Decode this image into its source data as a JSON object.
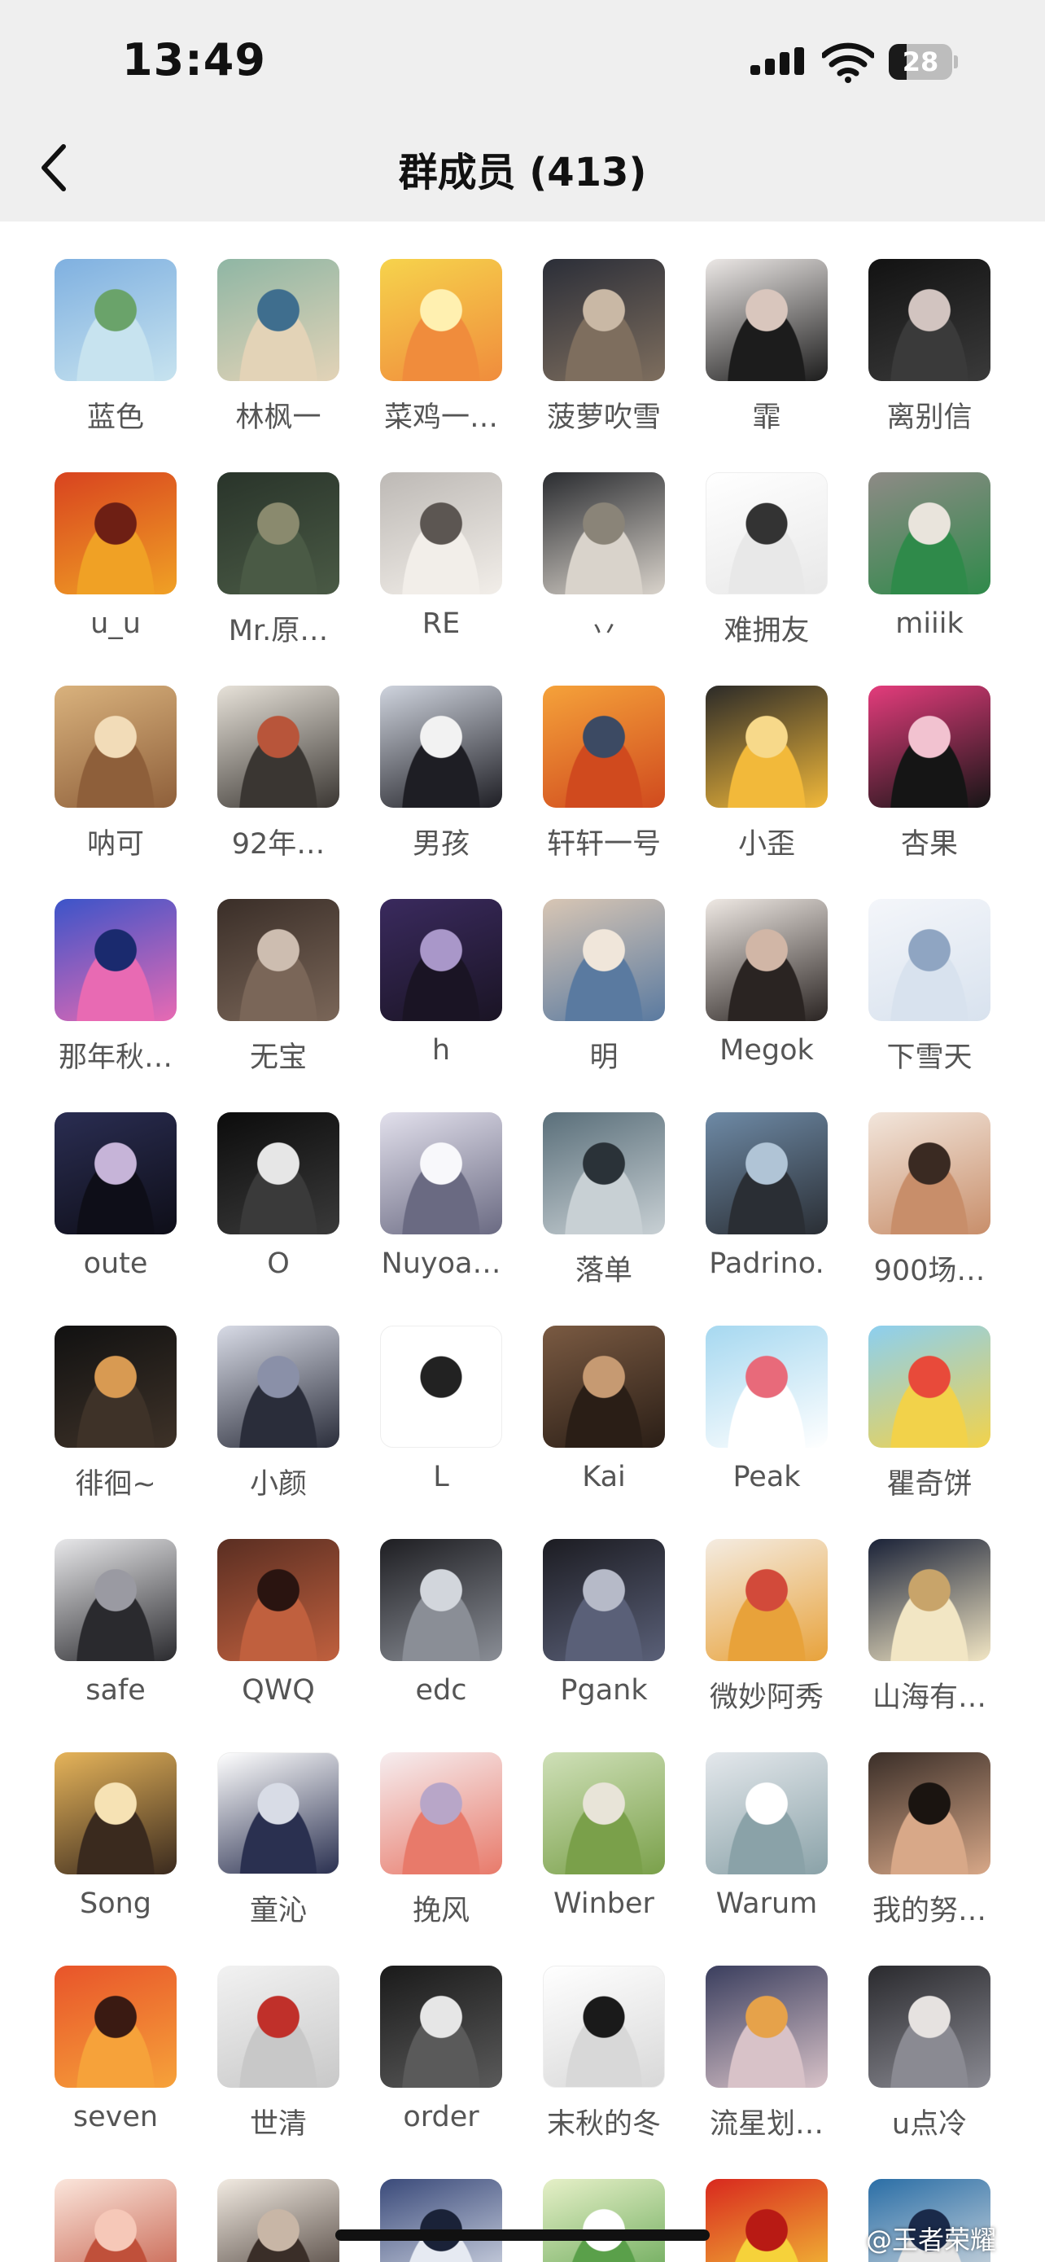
{
  "status_bar": {
    "time": "13:49",
    "battery": "28",
    "battery_fraction": 0.28,
    "icons": [
      "signal-icon",
      "wifi-icon",
      "battery-icon"
    ]
  },
  "nav": {
    "back_icon": "chevron-left-icon",
    "title": "群成员 (413)"
  },
  "members": [
    {
      "name": "蓝色",
      "colors": [
        "#7fb0e0",
        "#c7e3ef",
        "#6aa36a"
      ]
    },
    {
      "name": "林枫一",
      "colors": [
        "#8fb6a4",
        "#e3d3b7",
        "#3f6e8e"
      ]
    },
    {
      "name": "菜鸡一…",
      "colors": [
        "#f6d34c",
        "#f08c3c",
        "#fff0b0"
      ]
    },
    {
      "name": "菠萝吹雪",
      "colors": [
        "#2b2e38",
        "#7e6e5e",
        "#c9b8a5"
      ]
    },
    {
      "name": "霏",
      "colors": [
        "#ece8e6",
        "#1c1c1c",
        "#d9c6bd"
      ]
    },
    {
      "name": "离别信",
      "colors": [
        "#121212",
        "#3a3a3a",
        "#d2c4c0"
      ]
    },
    {
      "name": "u_u",
      "colors": [
        "#d8431f",
        "#f0a125",
        "#6e1f14"
      ]
    },
    {
      "name": "Mr.原…",
      "colors": [
        "#29342a",
        "#4a5a45",
        "#8a8a6e"
      ]
    },
    {
      "name": "RE",
      "colors": [
        "#bdb9b5",
        "#f2eee9",
        "#5c5652"
      ]
    },
    {
      "name": "丷",
      "colors": [
        "#2a2c30",
        "#d9d3cb",
        "#8a8478"
      ]
    },
    {
      "name": "难拥友",
      "colors": [
        "#ffffff",
        "#e8e8e8",
        "#333333"
      ]
    },
    {
      "name": "miiik",
      "colors": [
        "#8e8a86",
        "#2f8a4a",
        "#e9e4dc"
      ]
    },
    {
      "name": "呐可",
      "colors": [
        "#d9b27d",
        "#8e5f3a",
        "#f2dcb8"
      ]
    },
    {
      "name": "92年…",
      "colors": [
        "#e7e2d9",
        "#3a3632",
        "#b8553a"
      ]
    },
    {
      "name": "男孩",
      "colors": [
        "#cfd4de",
        "#1e1e24",
        "#f2f2f2"
      ]
    },
    {
      "name": "轩轩一号",
      "colors": [
        "#f5a23a",
        "#d04a1e",
        "#3c4a63"
      ]
    },
    {
      "name": "小歪",
      "colors": [
        "#2b2a28",
        "#f2b93a",
        "#f7d98a"
      ]
    },
    {
      "name": "杏果",
      "colors": [
        "#e43c7c",
        "#151515",
        "#f2c2d0"
      ]
    },
    {
      "name": "那年秋…",
      "colors": [
        "#3b54c9",
        "#e86ab3",
        "#1a2a6e"
      ]
    },
    {
      "name": "无宝",
      "colors": [
        "#3a2e28",
        "#7a6658",
        "#cdbdb0"
      ]
    },
    {
      "name": "h",
      "colors": [
        "#3a2a5e",
        "#1a1424",
        "#a997c9"
      ]
    },
    {
      "name": "明",
      "colors": [
        "#d8c6b4",
        "#5a7aa0",
        "#f0e6da"
      ]
    },
    {
      "name": "Megok",
      "colors": [
        "#efe9e4",
        "#2a2422",
        "#d1b6a6"
      ]
    },
    {
      "name": "下雪天",
      "colors": [
        "#f4f6fa",
        "#d8e2ee",
        "#8fa5c2"
      ]
    },
    {
      "name": "oute",
      "colors": [
        "#2a2d52",
        "#0e0e18",
        "#c6b4d8"
      ]
    },
    {
      "name": "O",
      "colors": [
        "#0c0c0c",
        "#3a3a3a",
        "#e6e6e6"
      ]
    },
    {
      "name": "Nuyoa…",
      "colors": [
        "#e2e0ec",
        "#6a6a82",
        "#f8f8fb"
      ]
    },
    {
      "name": "落单",
      "colors": [
        "#5a6f7a",
        "#c8d0d4",
        "#2a3238"
      ]
    },
    {
      "name": "Padrino.",
      "colors": [
        "#6e8aa6",
        "#2a2e34",
        "#b0c4d6"
      ]
    },
    {
      "name": "900场…",
      "colors": [
        "#f2e6dc",
        "#c88e6a",
        "#3a2a22"
      ]
    },
    {
      "name": "徘徊~",
      "colors": [
        "#111111",
        "#3e3228",
        "#d89a52"
      ]
    },
    {
      "name": "小颜",
      "colors": [
        "#d8dbe6",
        "#2a2d3a",
        "#8a90a8"
      ]
    },
    {
      "name": "L",
      "colors": [
        "#ffffff",
        "#ffffff",
        "#222222"
      ]
    },
    {
      "name": "Kai",
      "colors": [
        "#7a5a42",
        "#2a1e16",
        "#c69a72"
      ]
    },
    {
      "name": "Peak",
      "colors": [
        "#a6d8f0",
        "#ffffff",
        "#e86a7a"
      ]
    },
    {
      "name": "瞿奇饼",
      "colors": [
        "#8ccff0",
        "#f2d24a",
        "#e84a3a"
      ]
    },
    {
      "name": "safe",
      "colors": [
        "#e8e8ea",
        "#2a2a2e",
        "#9a9aa2"
      ]
    },
    {
      "name": "QWQ",
      "colors": [
        "#5a2e22",
        "#c0603e",
        "#2a1410"
      ]
    },
    {
      "name": "edc",
      "colors": [
        "#1e1e22",
        "#8a8e96",
        "#d2d6dc"
      ]
    },
    {
      "name": "Pgank",
      "colors": [
        "#1c1c22",
        "#5a6078",
        "#b6bac8"
      ]
    },
    {
      "name": "微妙阿秀",
      "colors": [
        "#f4ece2",
        "#e8a23a",
        "#d24a3a"
      ]
    },
    {
      "name": "山海有…",
      "colors": [
        "#1a2238",
        "#f2e6c4",
        "#c8a46a"
      ]
    },
    {
      "name": "Song",
      "colors": [
        "#e6b45a",
        "#3a2a1e",
        "#f6e2b4"
      ]
    },
    {
      "name": "童沁",
      "colors": [
        "#ffffff",
        "#2a3050",
        "#d8dce6"
      ]
    },
    {
      "name": "挽风",
      "colors": [
        "#f6eef0",
        "#e87a6a",
        "#b8a6c8"
      ]
    },
    {
      "name": "Winber",
      "colors": [
        "#cfe0b8",
        "#7aa04a",
        "#e8e4d8"
      ]
    },
    {
      "name": "Warum",
      "colors": [
        "#e4e8ec",
        "#8aa2a8",
        "#ffffff"
      ]
    },
    {
      "name": "我的努…",
      "colors": [
        "#3a2e28",
        "#d8a888",
        "#1a1410"
      ]
    },
    {
      "name": "seven",
      "colors": [
        "#e8542a",
        "#f6a23a",
        "#3a1a12"
      ]
    },
    {
      "name": "世清",
      "colors": [
        "#f2f2f2",
        "#c8c8c8",
        "#c0302a"
      ]
    },
    {
      "name": "order",
      "colors": [
        "#1a1a1a",
        "#5a5a5a",
        "#e6e6e6"
      ]
    },
    {
      "name": "末秋的冬",
      "colors": [
        "#ffffff",
        "#d8d8d8",
        "#1a1a1a"
      ]
    },
    {
      "name": "流星划…",
      "colors": [
        "#3a3e5e",
        "#d8c2c8",
        "#e6a24a"
      ]
    },
    {
      "name": "u点冷",
      "colors": [
        "#2a2a2e",
        "#8a8a92",
        "#e6e2e0"
      ]
    },
    {
      "name": "",
      "colors": [
        "#fbe6dc",
        "#c0503a",
        "#f6c8b8"
      ]
    },
    {
      "name": "",
      "colors": [
        "#f2ebe2",
        "#3a2e28",
        "#c8b6a6"
      ]
    },
    {
      "name": "",
      "colors": [
        "#3a4a7a",
        "#e6eaf2",
        "#1a2238"
      ]
    },
    {
      "name": "",
      "colors": [
        "#e6f0c8",
        "#5aa04a",
        "#ffffff"
      ]
    },
    {
      "name": "",
      "colors": [
        "#d8281e",
        "#f6d23a",
        "#b81a14"
      ]
    },
    {
      "name": "",
      "colors": [
        "#2a6ea6",
        "#e6e6e6",
        "#1a2a4a"
      ]
    }
  ],
  "watermark": "@王者荣耀"
}
